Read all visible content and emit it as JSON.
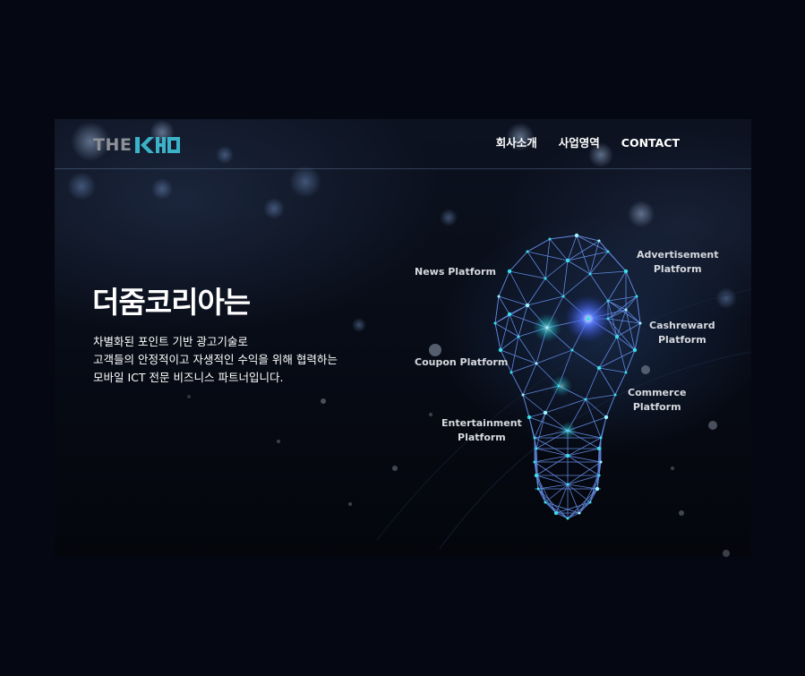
{
  "brand": {
    "logo_the": "THE",
    "logo_accent_color": "#3ab3c8"
  },
  "nav": {
    "items": [
      {
        "label": "회사소개"
      },
      {
        "label": "사업영역"
      },
      {
        "label": "CONTACT"
      }
    ]
  },
  "hero": {
    "title": "더줌코리아는",
    "description_lines": [
      "차별화된 포인트 기반 광고기술로",
      "고객들의 안정적이고 자생적인 수익을 위해 협력하는",
      "모바일 ICT 전문 비즈니스 파트너입니다."
    ]
  },
  "platforms": {
    "news": [
      "News Platform"
    ],
    "coupon": [
      "Coupon Platform"
    ],
    "entertainment": [
      "Entertainment",
      "Platform"
    ],
    "advertisement": [
      "Advertisement",
      "Platform"
    ],
    "cashreward": [
      "Cashreward",
      "Platform"
    ],
    "commerce": [
      "Commerce",
      "Platform"
    ]
  },
  "colors": {
    "background": "#050713",
    "bulb_line": "#5a8ee6",
    "bulb_node": "#38e0e8",
    "bulb_glow": "#3a6cff"
  }
}
